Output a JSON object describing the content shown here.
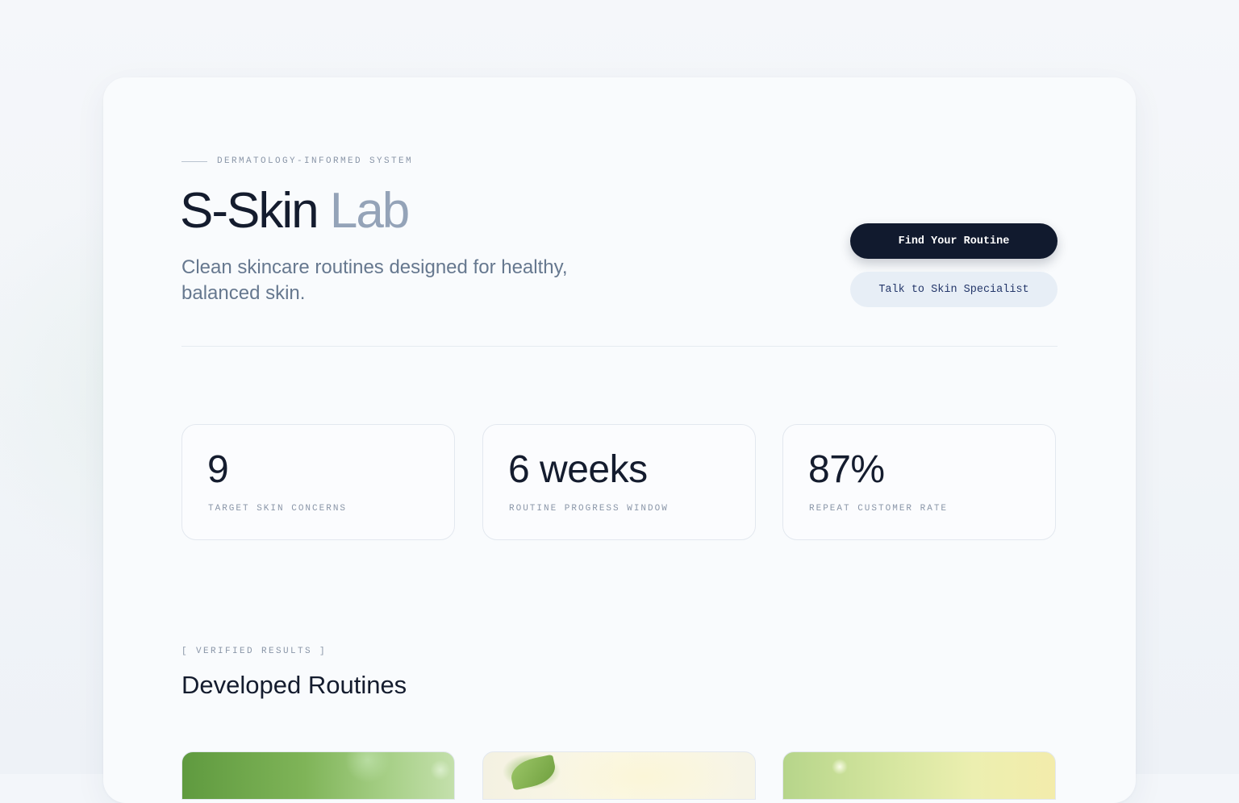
{
  "hero": {
    "eyebrow": "DERMATOLOGY-INFORMED SYSTEM",
    "title_main": "S-Skin",
    "title_accent": "Lab",
    "subtitle": "Clean skincare routines designed for healthy, balanced skin."
  },
  "actions": {
    "primary_label": "Find Your Routine",
    "secondary_label": "Talk to Skin Specialist"
  },
  "stats": [
    {
      "value": "9",
      "label": "TARGET SKIN CONCERNS"
    },
    {
      "value": "6 weeks",
      "label": "ROUTINE PROGRESS WINDOW"
    },
    {
      "value": "87%",
      "label": "REPEAT CUSTOMER RATE"
    }
  ],
  "results": {
    "eyebrow": "[ VERIFIED RESULTS ]",
    "title": "Developed Routines"
  },
  "colors": {
    "primary_button": "#111a2e",
    "secondary_button": "#e7eef6",
    "accent_text": "#94a3b8"
  }
}
